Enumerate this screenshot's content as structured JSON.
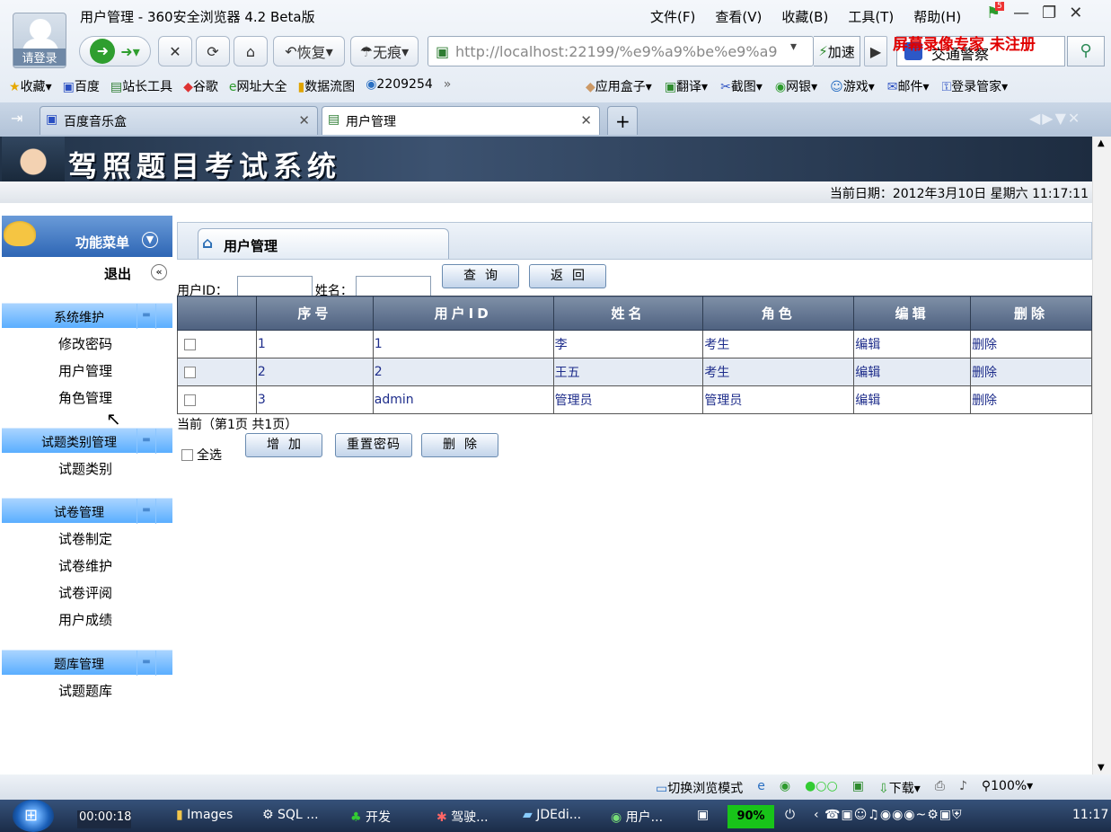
{
  "browser": {
    "avatar_label": "请登录",
    "window_title": "用户管理 - 360安全浏览器 4.2 Beta版",
    "menus": [
      "文件(F)",
      "查看(V)",
      "收藏(B)",
      "工具(T)",
      "帮助(H)"
    ],
    "notification_count": "5",
    "restore_label": "恢复",
    "incognito_label": "无痕",
    "address": "http://localhost:22199/%e9%a9%be%e9%a9",
    "speed_label": "加速",
    "search_value": "交通警察",
    "watermark": "屏幕录像专家  未注册",
    "favorites_left": [
      "收藏",
      "百度",
      "站长工具",
      "谷歌",
      "网址大全",
      "数据流图",
      "2209254",
      "»"
    ],
    "favorites_right": [
      "应用盒子",
      "翻译",
      "截图",
      "网银",
      "游戏",
      "邮件",
      "登录管家"
    ],
    "tabs": [
      {
        "label": "百度音乐盒"
      },
      {
        "label": "用户管理"
      }
    ]
  },
  "page": {
    "system_title": "驾照题目考试系统",
    "date_label": "当前日期：",
    "date_value": "2012年3月10日  星期六    11:17:11"
  },
  "sidebar": {
    "header": "功能菜单",
    "logout": "退出",
    "sections": [
      {
        "title": "系统维护",
        "items": [
          "修改密码",
          "用户管理",
          "角色管理"
        ]
      },
      {
        "title": "试题类别管理",
        "items": [
          "试题类别"
        ]
      },
      {
        "title": "试卷管理",
        "items": [
          "试卷制定",
          "试卷维护",
          "试卷评阅",
          "用户成绩"
        ]
      },
      {
        "title": "题库管理",
        "items": [
          "试题题库"
        ]
      }
    ]
  },
  "main": {
    "tab_title": "用户管理",
    "filter": {
      "userid_label": "用户ID：",
      "name_label": "姓名：",
      "query_button": "查询",
      "back_button": "返回"
    },
    "table": {
      "columns": [
        "序号",
        "用户ID",
        "姓名",
        "角色",
        "编辑",
        "删除"
      ],
      "rows": [
        {
          "seq": "1",
          "userid": "1",
          "name": "李",
          "role": "考生",
          "edit": "编辑",
          "delete": "删除"
        },
        {
          "seq": "2",
          "userid": "2",
          "name": "王五",
          "role": "考生",
          "edit": "编辑",
          "delete": "删除"
        },
        {
          "seq": "3",
          "userid": "admin",
          "name": "管理员",
          "role": "管理员",
          "edit": "编辑",
          "delete": "删除"
        }
      ]
    },
    "pagination": "当前（第1页  共1页）",
    "select_all": "全选",
    "add_button": "增加",
    "reset_password_button": "重置密码",
    "delete_button": "删除"
  },
  "statusbar": {
    "mode": "切换浏览模式",
    "download": "下载",
    "zoom": "100%"
  },
  "taskbar": {
    "recorder_time": "00:00:18",
    "items": [
      "Images",
      "SQL ...",
      "开发",
      "驾驶...",
      "JDEdi...",
      "用户..."
    ],
    "battery": "90%",
    "clock": "11:17"
  }
}
